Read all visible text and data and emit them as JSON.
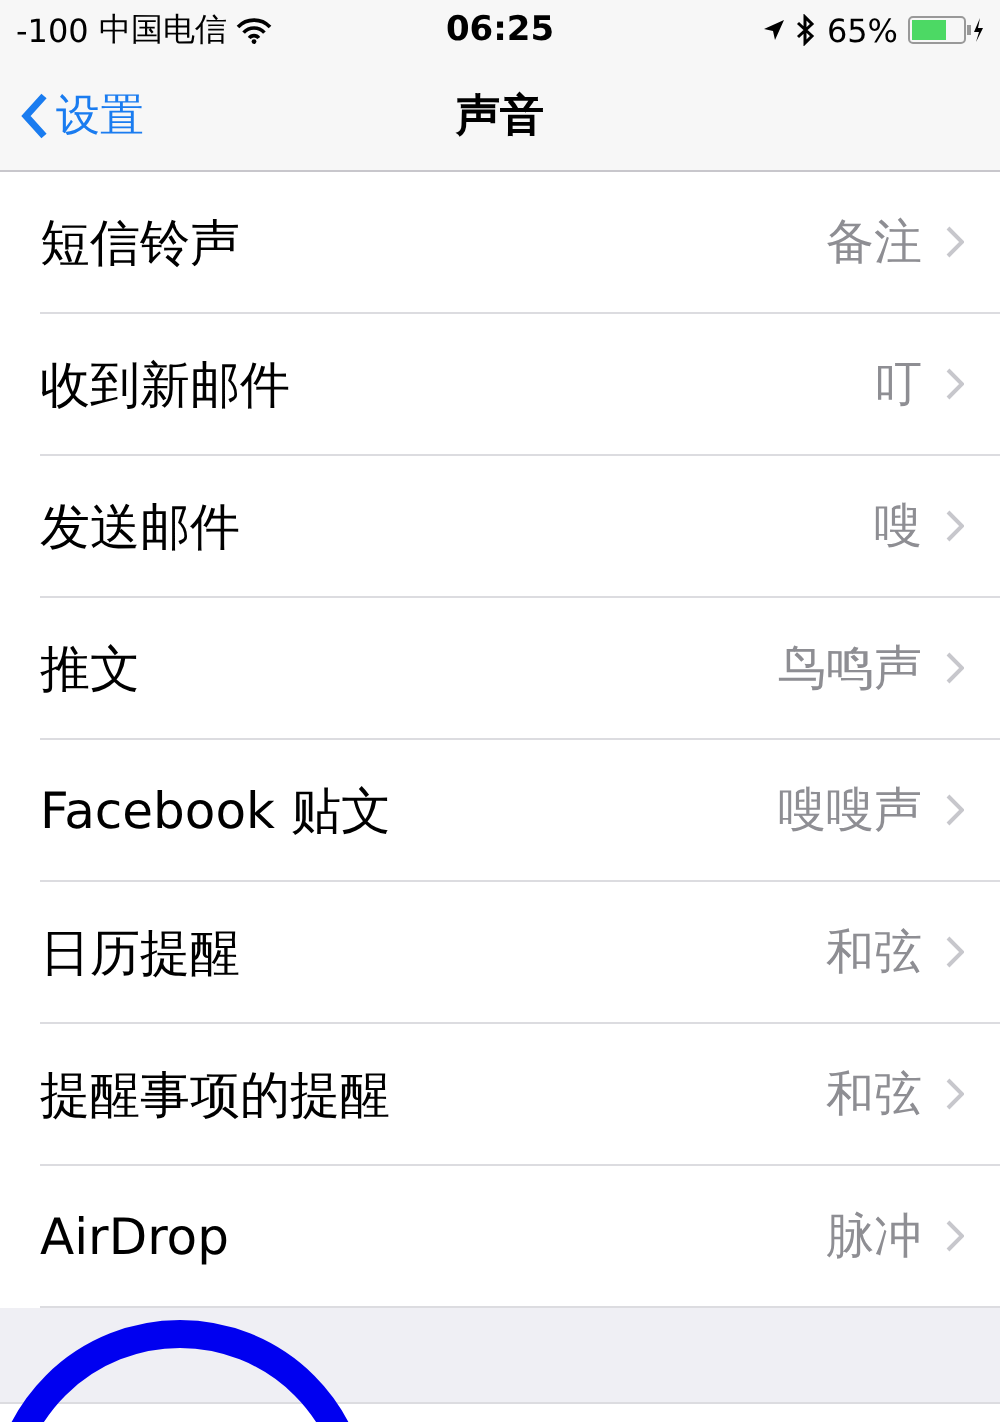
{
  "status_bar": {
    "signal": "-100",
    "carrier": "中国电信",
    "time": "06:25",
    "battery": "65%"
  },
  "nav_bar": {
    "back": "设置",
    "title": "声音"
  },
  "rows": [
    {
      "label": "短信铃声",
      "value": "备注"
    },
    {
      "label": "收到新邮件",
      "value": "叮"
    },
    {
      "label": "发送邮件",
      "value": "嗖"
    },
    {
      "label": "推文",
      "value": "鸟鸣声"
    },
    {
      "label": "Facebook 贴文",
      "value": "嗖嗖声"
    },
    {
      "label": "日历提醒",
      "value": "和弦"
    },
    {
      "label": "提醒事项的提醒",
      "value": "和弦"
    },
    {
      "label": "AirDrop",
      "value": "脉冲"
    }
  ]
}
